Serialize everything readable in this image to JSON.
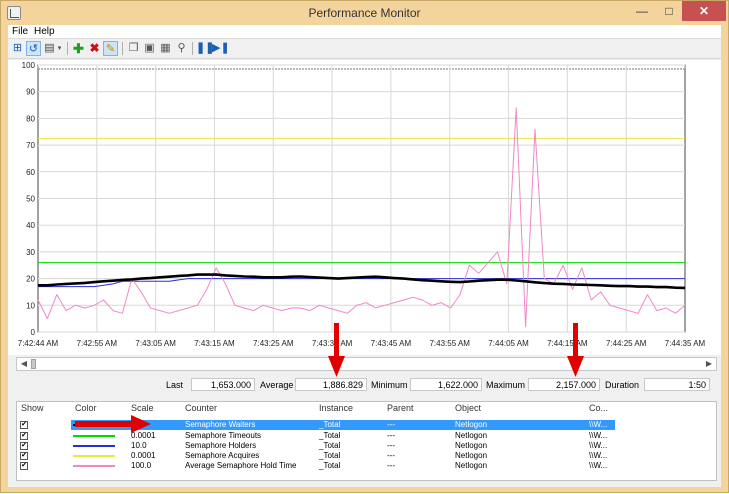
{
  "window": {
    "title": "Performance Monitor",
    "minimize": "—",
    "maximize": "□",
    "close": "✕"
  },
  "menu": {
    "file": "File",
    "help": "Help"
  },
  "chart_data": {
    "type": "line",
    "title": "",
    "ylim": [
      0,
      100
    ],
    "yticks": [
      "100",
      "90",
      "80",
      "70",
      "60",
      "50",
      "40",
      "30",
      "20",
      "10",
      "0"
    ],
    "xticks": [
      "7:42:44 AM",
      "7:42:55 AM",
      "7:43:05 AM",
      "7:43:15 AM",
      "7:43:25 AM",
      "7:43:35 AM",
      "7:43:45 AM",
      "7:43:55 AM",
      "7:44:05 AM",
      "7:44:15 AM",
      "7:44:25 AM",
      "7:44:35 AM"
    ],
    "grid": true,
    "series": [
      {
        "name": "Semaphore Waiters",
        "color": "#000000",
        "values": [
          17.5,
          17.5,
          17.8,
          18,
          18.2,
          18.4,
          18.7,
          19,
          19.2,
          19.5,
          19.7,
          20,
          20.2,
          20.5,
          20.7,
          21,
          21.2,
          21.5,
          21.5,
          21.5,
          21.2,
          21,
          20.8,
          20.7,
          20.5,
          20.5,
          20.5,
          20.7,
          20.8,
          20.6,
          20.4,
          20.2,
          20,
          20.2,
          20.4,
          20.6,
          20.7,
          20.5,
          20.2,
          20,
          19.7,
          19.4,
          19.2,
          19,
          18.8,
          18.7,
          18.9,
          19.2,
          19.4,
          19.6,
          19.6,
          19.3,
          19,
          18.6,
          18.3,
          18.1,
          18,
          17.8,
          17.7,
          17.6,
          17.5,
          17.3,
          17.2,
          17.2,
          17,
          17,
          16.8,
          16.8,
          16.6,
          16.5
        ]
      },
      {
        "name": "Semaphore Timeouts",
        "color": "#00dd00",
        "values": [
          26,
          26,
          26,
          26,
          26,
          26,
          26,
          26,
          26,
          26,
          26,
          26,
          26,
          26,
          26,
          26,
          26,
          26,
          26,
          26,
          26,
          26,
          26,
          26,
          26,
          26,
          26,
          26,
          26,
          26,
          26,
          26,
          26,
          26,
          26,
          26,
          26,
          26,
          26,
          26,
          26,
          26,
          26,
          26,
          26,
          26,
          26,
          26,
          26,
          26,
          26,
          26,
          26,
          26,
          26,
          26,
          26,
          26,
          26,
          26,
          26,
          26,
          26,
          26,
          26,
          26,
          26,
          26,
          26,
          26
        ]
      },
      {
        "name": "Semaphore Holders",
        "color": "#2b2bd9",
        "values": [
          17,
          17,
          17,
          17,
          17,
          17,
          17,
          17.5,
          18,
          19,
          19,
          19,
          19,
          19,
          19,
          19.5,
          20,
          20,
          20,
          20,
          20,
          20,
          20,
          20,
          20,
          20,
          20,
          20,
          20,
          20,
          20,
          20,
          20,
          20,
          20,
          20,
          20,
          20,
          20,
          20,
          20,
          20,
          20,
          20,
          20,
          20,
          20,
          20,
          20,
          20,
          20,
          20,
          20,
          20,
          20,
          20,
          20,
          20,
          20,
          20,
          20,
          20,
          20,
          20,
          20,
          20,
          20,
          20,
          20,
          20
        ]
      },
      {
        "name": "Semaphore Acquires",
        "color": "#e8e840",
        "values": [
          72.5,
          72.5,
          72.5,
          72.5,
          72.5,
          72.5,
          72.5,
          72.5,
          72.5,
          72.5,
          72.5,
          72.5,
          72.5,
          72.5,
          72.5,
          72.5,
          72.5,
          72.5,
          72.5,
          72.5,
          72.5,
          72.5,
          72.5,
          72.5,
          72.5,
          72.5,
          72.5,
          72.5,
          72.5,
          72.5,
          72.5,
          72.5,
          72.5,
          72.5,
          72.5,
          72.5,
          72.5,
          72.5,
          72.5,
          72.5,
          72.5,
          72.5,
          72.5,
          72.5,
          72.5,
          72.5,
          72.5,
          72.5,
          72.5,
          72.5,
          72.5,
          72.5,
          72.5,
          72.5,
          72.5,
          72.5,
          72.5,
          72.5,
          72.5,
          72.5,
          72.5,
          72.5,
          72.5,
          72.5,
          72.5,
          72.5,
          72.5,
          72.5,
          72.5,
          72.5
        ]
      },
      {
        "name": "Average Semaphore Hold Time",
        "color": "#ee88c8",
        "values": [
          12,
          5,
          14,
          8,
          10,
          9,
          10,
          12,
          8,
          7,
          20,
          15,
          9,
          8,
          7,
          8,
          9,
          10,
          16,
          24,
          18,
          10,
          9,
          8,
          10,
          9,
          8,
          9,
          9,
          8,
          10,
          9,
          8,
          7,
          10,
          11,
          9,
          10,
          11,
          12,
          13,
          12,
          10,
          11,
          9,
          14,
          25,
          22,
          26,
          30,
          18,
          84,
          2,
          76,
          20,
          18,
          25,
          16,
          24,
          12,
          15,
          10,
          9,
          8,
          7,
          14,
          8,
          9,
          7,
          10
        ]
      }
    ]
  },
  "scrollbar": {
    "left": "◀",
    "right": "▶"
  },
  "stats": {
    "last_label": "Last",
    "last_value": "1,653.000",
    "average_label": "Average",
    "average_value": "1,886.829",
    "minimum_label": "Minimum",
    "minimum_value": "1,622.000",
    "maximum_label": "Maximum",
    "maximum_value": "2,157.000",
    "duration_label": "Duration",
    "duration_value": "1:50"
  },
  "counters": {
    "headers": {
      "show": "Show",
      "color": "Color",
      "scale": "Scale",
      "counter": "Counter",
      "instance": "Instance",
      "parent": "Parent",
      "object": "Object",
      "computer": "Co..."
    },
    "rows": [
      {
        "checked": "✔",
        "color": "#000000",
        "scale": "",
        "counter": "Semaphore Waiters",
        "instance": "_Total",
        "parent": "---",
        "object": "Netlogon",
        "computer": "\\\\W..."
      },
      {
        "checked": "✔",
        "color": "#00dd00",
        "scale": "0.0001",
        "counter": "Semaphore Timeouts",
        "instance": "_Total",
        "parent": "---",
        "object": "Netlogon",
        "computer": "\\\\W..."
      },
      {
        "checked": "✔",
        "color": "#2b2bd9",
        "scale": "10.0",
        "counter": "Semaphore Holders",
        "instance": "_Total",
        "parent": "---",
        "object": "Netlogon",
        "computer": "\\\\W..."
      },
      {
        "checked": "✔",
        "color": "#e8e840",
        "scale": "0.0001",
        "counter": "Semaphore Acquires",
        "instance": "_Total",
        "parent": "---",
        "object": "Netlogon",
        "computer": "\\\\W..."
      },
      {
        "checked": "✔",
        "color": "#ee88c8",
        "scale": "100.0",
        "counter": "Average Semaphore Hold Time",
        "instance": "_Total",
        "parent": "---",
        "object": "Netlogon",
        "computer": "\\\\W..."
      }
    ]
  },
  "colors": {
    "title_bar": "#f2d49c",
    "close": "#c75050",
    "selection": "#3399ff",
    "annotation_arrow": "#e00000"
  }
}
